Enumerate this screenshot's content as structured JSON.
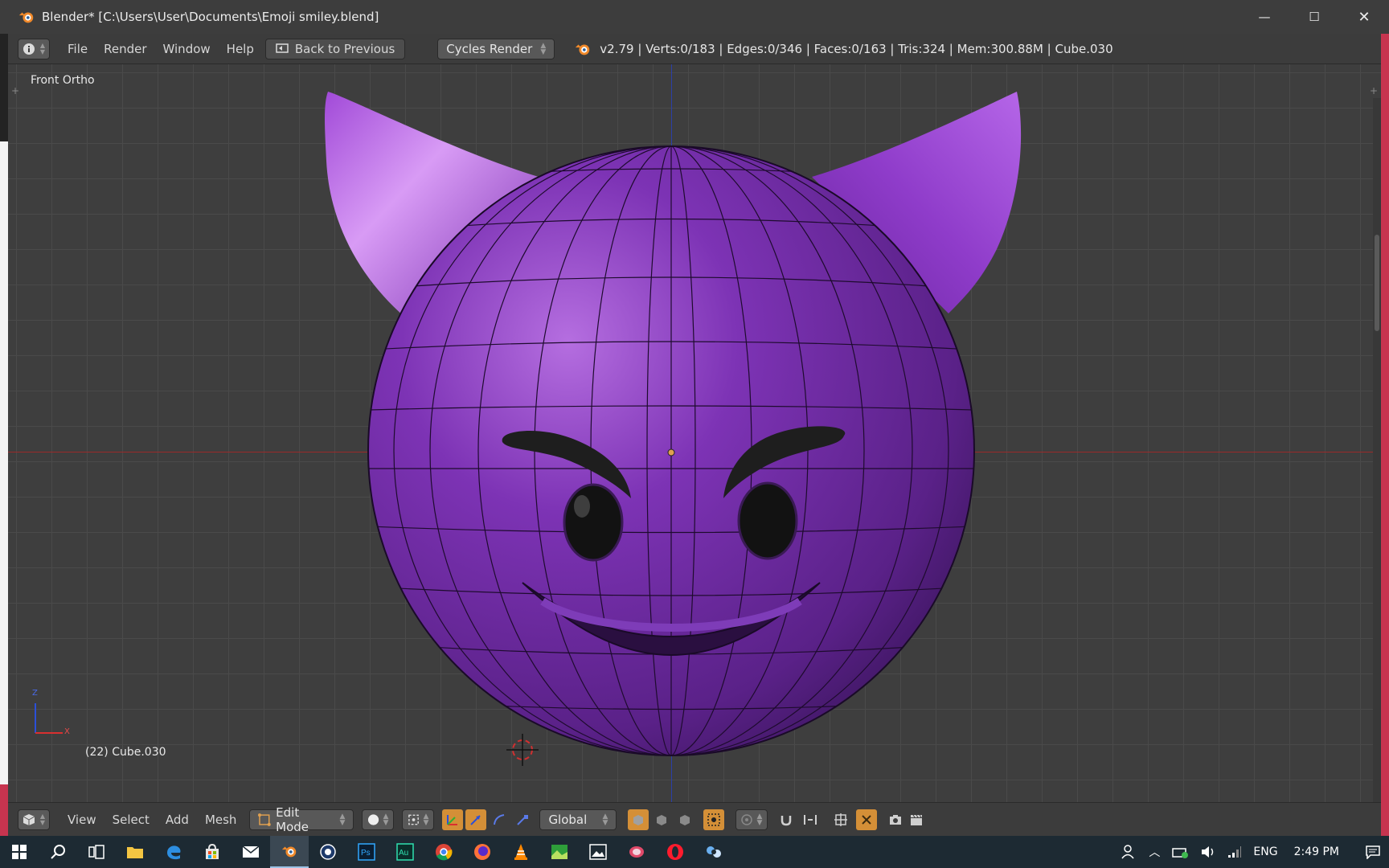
{
  "window": {
    "title": "Blender* [C:\\Users\\User\\Documents\\Emoji smiley.blend]",
    "minimize": "—",
    "maximize": "☐",
    "close": "✕"
  },
  "info_header": {
    "menu": [
      "File",
      "Render",
      "Window",
      "Help"
    ],
    "back_button": "Back to Previous",
    "render_engine": "Cycles Render",
    "stats": "v2.79 | Verts:0/183 | Edges:0/346 | Faces:0/163 | Tris:324 | Mem:300.88M | Cube.030"
  },
  "viewport": {
    "view_label": "Front Ortho",
    "object_label": "(22) Cube.030",
    "axis_z": "Z",
    "axis_x": "X",
    "colors": {
      "face_purple": "#6a2a9a",
      "horn_purple": "#9a4ad0",
      "feature_black": "#1b1b1b"
    }
  },
  "view3d_header": {
    "menu": [
      "View",
      "Select",
      "Add",
      "Mesh"
    ],
    "mode": "Edit Mode",
    "orientation": "Global"
  },
  "taskbar": {
    "language": "ENG",
    "time": "2:49 PM"
  }
}
